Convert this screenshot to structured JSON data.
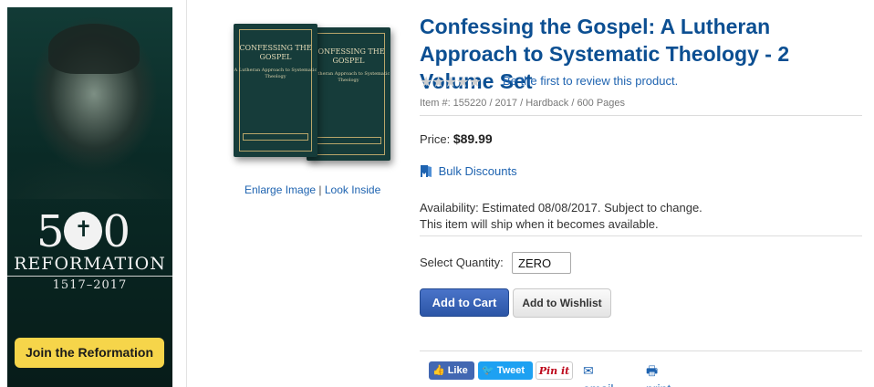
{
  "banner": {
    "number": "500",
    "title": "REFORMATION",
    "years": "1517–2017",
    "cta_label": "Join the Reformation"
  },
  "product_image": {
    "cover_title": "CONFESSING THE GOSPEL",
    "cover_subtitle": "A Lutheran Approach to Systematic Theology",
    "enlarge_label": "Enlarge Image",
    "separator": "|",
    "look_inside_label": "Look Inside"
  },
  "product": {
    "title": "Confessing the Gospel: A Lutheran Approach to Systematic Theology - 2 Volume Set",
    "rating": {
      "stars": "★★★★★",
      "review_prompt": "Be the first to review this product."
    },
    "meta": "Item #: 155220 / 2017 / Hardback / 600 Pages",
    "price_label": "Price:",
    "price_value": "$89.99",
    "bulk_label": "Bulk Discounts",
    "availability_line1": "Availability: Estimated 08/08/2017. Subject to change.",
    "availability_line2": "This item will ship when it becomes available.",
    "quantity_label": "Select Quantity:",
    "quantity_value": "ZERO",
    "add_to_cart_label": "Add to Cart",
    "add_to_wishlist_label": "Add to Wishlist"
  },
  "share": {
    "facebook_label": "Like",
    "twitter_label": "Tweet",
    "pinterest_label": "Pin it",
    "email_label": "email",
    "print_label": "print"
  },
  "colors": {
    "link": "#1e63b0",
    "title": "#0c4f92",
    "cta_yellow": "#f6d54a",
    "cart_blue": "#2b55a6"
  }
}
